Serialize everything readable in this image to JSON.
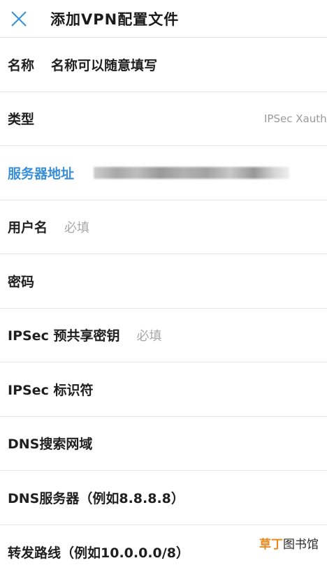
{
  "header": {
    "title": "添加VPN配置文件",
    "close_icon": "close-icon",
    "accent_color": "#3a8fd9"
  },
  "form": {
    "name": {
      "label": "名称",
      "value": "名称可以随意填写"
    },
    "type": {
      "label": "类型",
      "value": "IPSec Xauth"
    },
    "server": {
      "label": "服务器地址"
    },
    "username": {
      "label": "用户名",
      "placeholder": "必填"
    },
    "password": {
      "label": "密码"
    },
    "psk": {
      "label": "IPSec 预共享密钥",
      "placeholder": "必填"
    },
    "identifier": {
      "label": "IPSec 标识符"
    },
    "dns_search": {
      "label": "DNS搜索网域"
    },
    "dns_server": {
      "label": "DNS服务器（例如8.8.8.8）"
    },
    "routes": {
      "label": "转发路线（例如10.0.0.0/8）"
    }
  },
  "watermark": {
    "accent": "草丁",
    "rest": "图书馆",
    "accent_color": "#e8891d"
  }
}
